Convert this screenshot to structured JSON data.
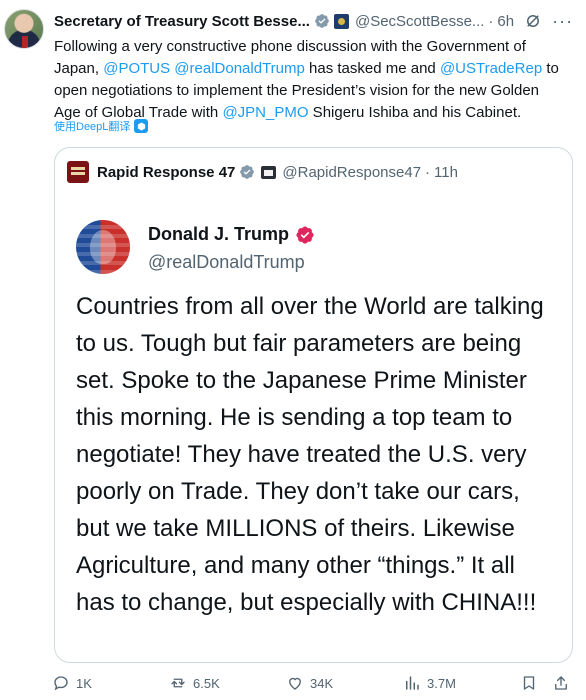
{
  "tweet": {
    "author_name": "Secretary of Treasury Scott Besse...",
    "author_handle": "@SecScottBesse...",
    "dot": "·",
    "time": "6h",
    "text_parts": [
      "Following a very constructive phone discussion with the Government of Japan, ",
      "@POTUS",
      " ",
      "@realDonaldTrump",
      " has tasked me and ",
      "@USTradeRep",
      " to open negotiations to implement the President’s vision for the new Golden Age of Global Trade with ",
      "@JPN_PMO",
      " Shigeru Ishiba and his Cabinet."
    ],
    "translate_label": "使用DeepL翻译"
  },
  "quote": {
    "author_name": "Rapid Response 47",
    "author_handle": "@RapidResponse47",
    "dot": "·",
    "time": "11h",
    "inner_name": "Donald J. Trump",
    "inner_handle": "@realDonaldTrump",
    "inner_text": "Countries from all over the World are talking to us. Tough but fair parameters are being set. Spoke to the Japanese Prime Minister this morning. He is sending a top team to negotiate! They have treated the U.S. very poorly on Trade. They don’t take our cars, but we take MILLIONS of theirs. Likewise Agriculture, and many other “things.” It all has to change, but especially with CHINA!!!"
  },
  "actions": {
    "replies": "1K",
    "reposts": "6.5K",
    "likes": "34K",
    "views": "3.7M"
  },
  "colors": {
    "accent": "#1d9bf0",
    "muted": "#536471",
    "text": "#0f1419",
    "border": "#cfd9de",
    "verified_grey": "#829aab",
    "verified_gold": "#e0245e"
  },
  "icons": [
    "avatar",
    "grey-verified-icon",
    "government-badge-icon",
    "grok-icon",
    "more-icon",
    "deepl-icon",
    "gold-verified-icon",
    "white-house-badge-icon",
    "pink-verified-icon",
    "reply-icon",
    "repost-icon",
    "like-icon",
    "views-icon",
    "bookmark-icon",
    "share-icon"
  ]
}
